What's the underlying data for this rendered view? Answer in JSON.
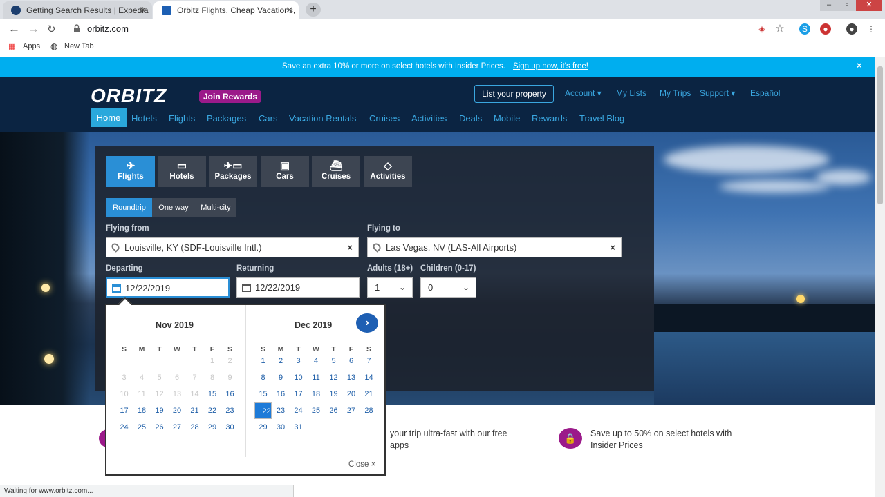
{
  "browser": {
    "tabs": [
      {
        "title": "Getting Search Results | Expedia"
      },
      {
        "title": "Orbitz Flights, Cheap Vacations, "
      }
    ],
    "url": "orbitz.com",
    "bookmarks": [
      "Apps",
      "New Tab"
    ],
    "status": "Waiting for www.orbitz.com..."
  },
  "promo_bar": {
    "text": "Save an extra 10% or more on select hotels with Insider Prices.",
    "link": "Sign up now, it's free!",
    "close": "×"
  },
  "header": {
    "logo": "ORBITZ",
    "join_rewards": "Join Rewards",
    "list_property": "List your property",
    "top_links": [
      "Account ▾",
      "My Lists",
      "My Trips",
      "Support ▾",
      "Español"
    ],
    "nav": [
      "Home",
      "Hotels",
      "Flights",
      "Packages",
      "Cars",
      "Vacation Rentals",
      "Cruises",
      "Activities",
      "Deals",
      "Mobile",
      "Rewards",
      "Travel Blog"
    ]
  },
  "search": {
    "tabs": [
      "Flights",
      "Hotels",
      "Packages",
      "Cars",
      "Cruises",
      "Activities"
    ],
    "trip_types": [
      "Roundtrip",
      "One way",
      "Multi-city"
    ],
    "flying_from_label": "Flying from",
    "flying_from_value": "Louisville, KY (SDF-Louisville Intl.)",
    "flying_to_label": "Flying to",
    "flying_to_value": "Las Vegas, NV (LAS-All Airports)",
    "departing_label": "Departing",
    "departing_value": "12/22/2019",
    "returning_label": "Returning",
    "returning_value": "12/22/2019",
    "adults_label": "Adults (18+)",
    "adults_value": "1",
    "children_label": "Children (0-17)",
    "children_value": "0"
  },
  "calendar": {
    "months": [
      {
        "title": "Nov 2019",
        "days_of_week": [
          "S",
          "M",
          "T",
          "W",
          "T",
          "F",
          "S"
        ],
        "weeks": [
          [
            "",
            "",
            "",
            "",
            "",
            "1",
            "2"
          ],
          [
            "3",
            "4",
            "5",
            "6",
            "7",
            "8",
            "9"
          ],
          [
            "10",
            "11",
            "12",
            "13",
            "14",
            "15",
            "16"
          ],
          [
            "17",
            "18",
            "19",
            "20",
            "21",
            "22",
            "23"
          ],
          [
            "24",
            "25",
            "26",
            "27",
            "28",
            "29",
            "30"
          ]
        ],
        "disabled_through": 14
      },
      {
        "title": "Dec 2019",
        "days_of_week": [
          "S",
          "M",
          "T",
          "W",
          "T",
          "F",
          "S"
        ],
        "weeks": [
          [
            "1",
            "2",
            "3",
            "4",
            "5",
            "6",
            "7"
          ],
          [
            "8",
            "9",
            "10",
            "11",
            "12",
            "13",
            "14"
          ],
          [
            "15",
            "16",
            "17",
            "18",
            "19",
            "20",
            "21"
          ],
          [
            "22",
            "23",
            "24",
            "25",
            "26",
            "27",
            "28"
          ],
          [
            "29",
            "30",
            "31",
            "",
            "",
            "",
            ""
          ]
        ],
        "selected": "22"
      }
    ],
    "next_arrow": "›",
    "close_label": "Close ×"
  },
  "below_fold": {
    "app_promo_line1": "your trip ultra-fast with our free",
    "app_promo_line2": "apps",
    "insider_line1": "Save up to 50% on select hotels with",
    "insider_line2": "Insider Prices"
  },
  "colors": {
    "promo": "#00aeef",
    "header": "#0b2442",
    "accent": "#2a8fd6",
    "rewards": "#9b1a8a"
  }
}
